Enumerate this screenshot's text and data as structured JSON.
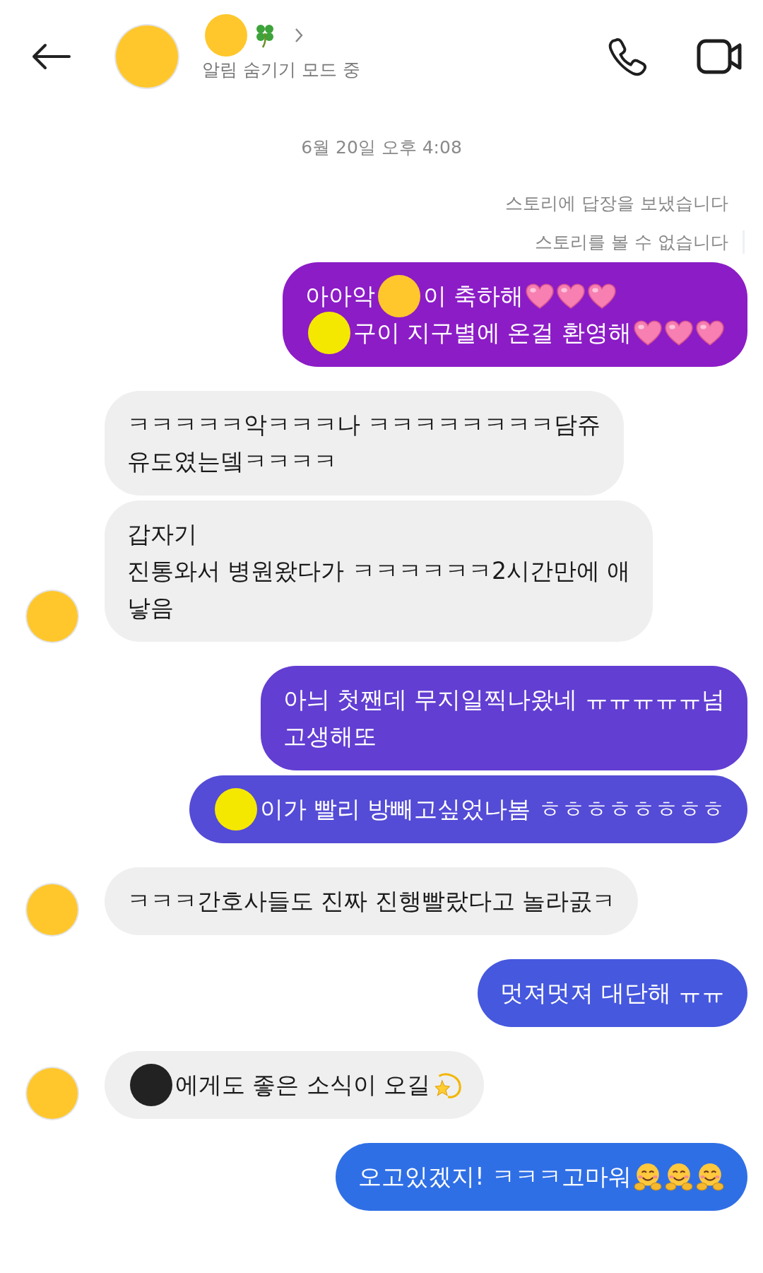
{
  "header": {
    "name_parts": [
      {
        "kind": "blot",
        "color": "#ffc72c"
      },
      {
        "kind": "clover"
      }
    ],
    "status": "알림 숨기기 모드 중"
  },
  "timestamp": "6월 20일 오후 4:08",
  "story_notes": [
    "스토리에 답장을 보냈습니다",
    "스토리를 볼 수 없습니다"
  ],
  "messages": [
    {
      "kind": "sent",
      "color": "#8c1cc6",
      "lines": [
        [
          {
            "kind": "text",
            "text": "아아악"
          },
          {
            "kind": "blot",
            "color": "#ffc72c"
          },
          {
            "kind": "text",
            "text": "이 축하해"
          },
          {
            "kind": "heart"
          },
          {
            "kind": "heart"
          },
          {
            "kind": "heart"
          }
        ],
        [
          {
            "kind": "blot",
            "color": "#f5e800"
          },
          {
            "kind": "text",
            "text": "구이 지구별에 온걸 환영해"
          },
          {
            "kind": "heart"
          },
          {
            "kind": "heart"
          },
          {
            "kind": "heart"
          }
        ]
      ]
    },
    {
      "kind": "received",
      "lines": [
        [
          {
            "kind": "text",
            "text": "ㅋㅋㅋㅋㅋ악ㅋㅋㅋ나 ㅋㅋㅋㅋㅋㅋㅋㅋ담쥬"
          }
        ],
        [
          {
            "kind": "text",
            "text": "유도였는뎈ㅋㅋㅋㅋ"
          }
        ]
      ]
    },
    {
      "kind": "received",
      "lines": [
        [
          {
            "kind": "text",
            "text": "갑자기"
          }
        ],
        [
          {
            "kind": "text",
            "text": "진통와서 병원왔다가 ㅋㅋㅋㅋㅋㅋ2시간만에 애"
          }
        ],
        [
          {
            "kind": "text",
            "text": "낳음"
          }
        ]
      ]
    },
    {
      "kind": "sent",
      "color": "#623ed2",
      "lines": [
        [
          {
            "kind": "text",
            "text": "아늬 첫짼데 무지일찍나왔네 ㅠㅠㅠㅠㅠ넘"
          }
        ],
        [
          {
            "kind": "text",
            "text": "고생해또"
          }
        ]
      ]
    },
    {
      "kind": "sent",
      "color": "#544bd6",
      "lines": [
        [
          {
            "kind": "blot",
            "color": "#f5e800"
          },
          {
            "kind": "text",
            "text": "이가 빨리 방빼고싶었나봄 ㅎㅎㅎㅎㅎㅎㅎㅎ"
          }
        ]
      ]
    },
    {
      "kind": "received",
      "lines": [
        [
          {
            "kind": "text",
            "text": "ㅋㅋㅋ간호사들도 진짜 진행빨랐다고 놀라곬ㅋ"
          }
        ]
      ]
    },
    {
      "kind": "sent",
      "color": "#4658de",
      "lines": [
        [
          {
            "kind": "text",
            "text": "멋져멋져 대단해 ㅠㅠ"
          }
        ]
      ]
    },
    {
      "kind": "received",
      "lines": [
        [
          {
            "kind": "blot",
            "color": "#222222"
          },
          {
            "kind": "text",
            "text": "에게도 좋은 소식이 오길"
          },
          {
            "kind": "dizzy"
          }
        ]
      ]
    },
    {
      "kind": "sent",
      "color": "#2f6fe6",
      "lines": [
        [
          {
            "kind": "text",
            "text": "오고있겠지! ㅋㅋㅋ고마워"
          },
          {
            "kind": "hug"
          },
          {
            "kind": "hug"
          },
          {
            "kind": "hug"
          }
        ]
      ]
    }
  ]
}
